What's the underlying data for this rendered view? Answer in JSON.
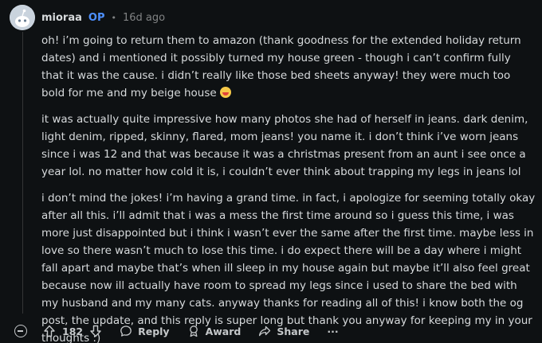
{
  "comment": {
    "username": "mioraa",
    "op_badge": "OP",
    "separator": "•",
    "timestamp": "16d ago",
    "paragraphs": [
      "oh! i’m going to return them to amazon (thank goodness for the extended holiday return dates) and i mentioned it possibly turned my house green - though i can’t confirm fully that it was the cause. i didn’t really like those bed sheets anyway! they were much too bold for me and my beige house",
      "it was actually quite impressive how many photos she had of herself in jeans. dark denim, light denim, ripped, skinny, flared, mom jeans! you name it. i don’t think i’ve worn jeans since i was 12 and that was because it was a christmas present from an aunt i see once a year lol. no matter how cold it is, i couldn’t ever think about trapping my legs in jeans lol",
      "i don’t mind the jokes! i’m having a grand time. in fact, i apologize for seeming totally okay after all this. i’ll admit that i was a mess the first time around so i guess this time, i was more just disappointed but i think i wasn’t ever the same after the first time. maybe less in love so there wasn’t much to lose this time. i do expect there will be a day where i might fall apart and maybe that’s when ill sleep in my house again but maybe it’ll also feel great because now ill actually have room to spread my legs since i used to share the bed with my husband and my many cats. anyway thanks for reading all of this! i know both the og post, the update, and this reply is super long but thank you anyway for keeping my in your thoughts :)"
    ],
    "emoji_icon": "grinning-squint-emoji"
  },
  "actions": {
    "vote_count": "182",
    "reply_label": "Reply",
    "award_label": "Award",
    "share_label": "Share",
    "more_label": "···"
  }
}
